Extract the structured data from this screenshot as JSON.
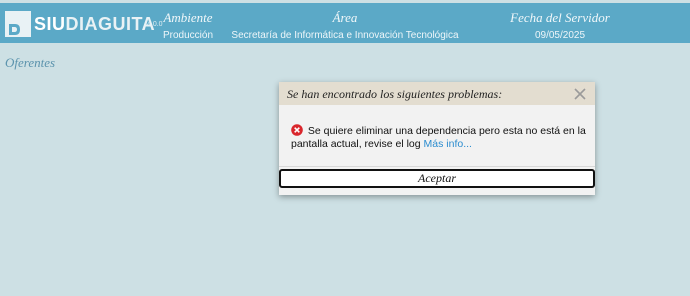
{
  "app": {
    "logo_prefix": "SIU",
    "logo_name": "DIAGUITA",
    "version": "4.0.0"
  },
  "header": {
    "ambiente_label": "Ambiente",
    "ambiente_value": "Producción",
    "area_label": "Área",
    "area_value": "Secretaría de Informática e Innovación Tecnológica",
    "fecha_label": "Fecha del Servidor",
    "fecha_value": "09/05/2025"
  },
  "page": {
    "title": "Oferentes"
  },
  "dialog": {
    "title": "Se han encontrado los siguientes problemas:",
    "message": "Se quiere eliminar una dependencia pero esta no está en la pantalla actual, revise el log",
    "more_link": "Más info...",
    "accept_label": "Aceptar",
    "close_icon": "close-icon",
    "error_icon": "error-icon"
  },
  "colors": {
    "header_bg": "#5ba9c7",
    "page_bg": "#cde0e4",
    "dialog_header_bg": "#e3ddd0",
    "link": "#2b8ccf",
    "error": "#d9262c"
  }
}
